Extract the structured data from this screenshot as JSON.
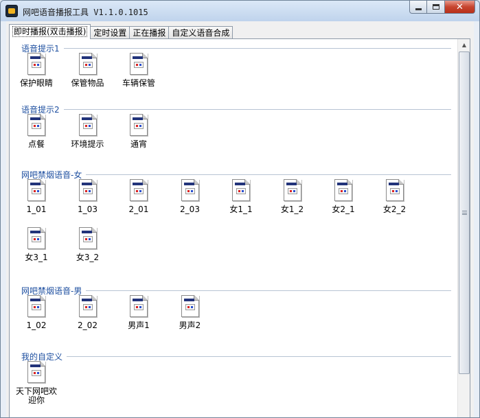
{
  "window": {
    "title": "网吧语音播报工具 V1.1.0.1015",
    "buttons": {
      "minimize": "minimize",
      "maximize": "maximize",
      "close": "✕"
    }
  },
  "tabs": [
    {
      "label": "即时播报(双击播报)",
      "active": true
    },
    {
      "label": "定时设置",
      "active": false
    },
    {
      "label": "正在播报",
      "active": false
    },
    {
      "label": "自定义语音合成",
      "active": false
    }
  ],
  "groups": [
    {
      "title": "语音提示1",
      "items": [
        "保护眼睛",
        "保管物品",
        "车辆保管"
      ]
    },
    {
      "title": "语音提示2",
      "items": [
        "点餐",
        "环境提示",
        "通宵"
      ]
    },
    {
      "title": "网吧禁烟语音-女",
      "items": [
        "1_01",
        "1_03",
        "2_01",
        "2_03",
        "女1_1",
        "女1_2",
        "女2_1",
        "女2_2",
        "女3_1",
        "女3_2"
      ]
    },
    {
      "title": "网吧禁烟语音-男",
      "items": [
        "1_02",
        "2_02",
        "男声1",
        "男声2"
      ]
    },
    {
      "title": "我的自定义",
      "items": [
        "天下网吧欢迎你"
      ]
    }
  ],
  "icons": {
    "file": "audio-file-icon",
    "scroll_up": "scroll-up-icon",
    "scroll_grip": "scroll-grip-icon"
  }
}
